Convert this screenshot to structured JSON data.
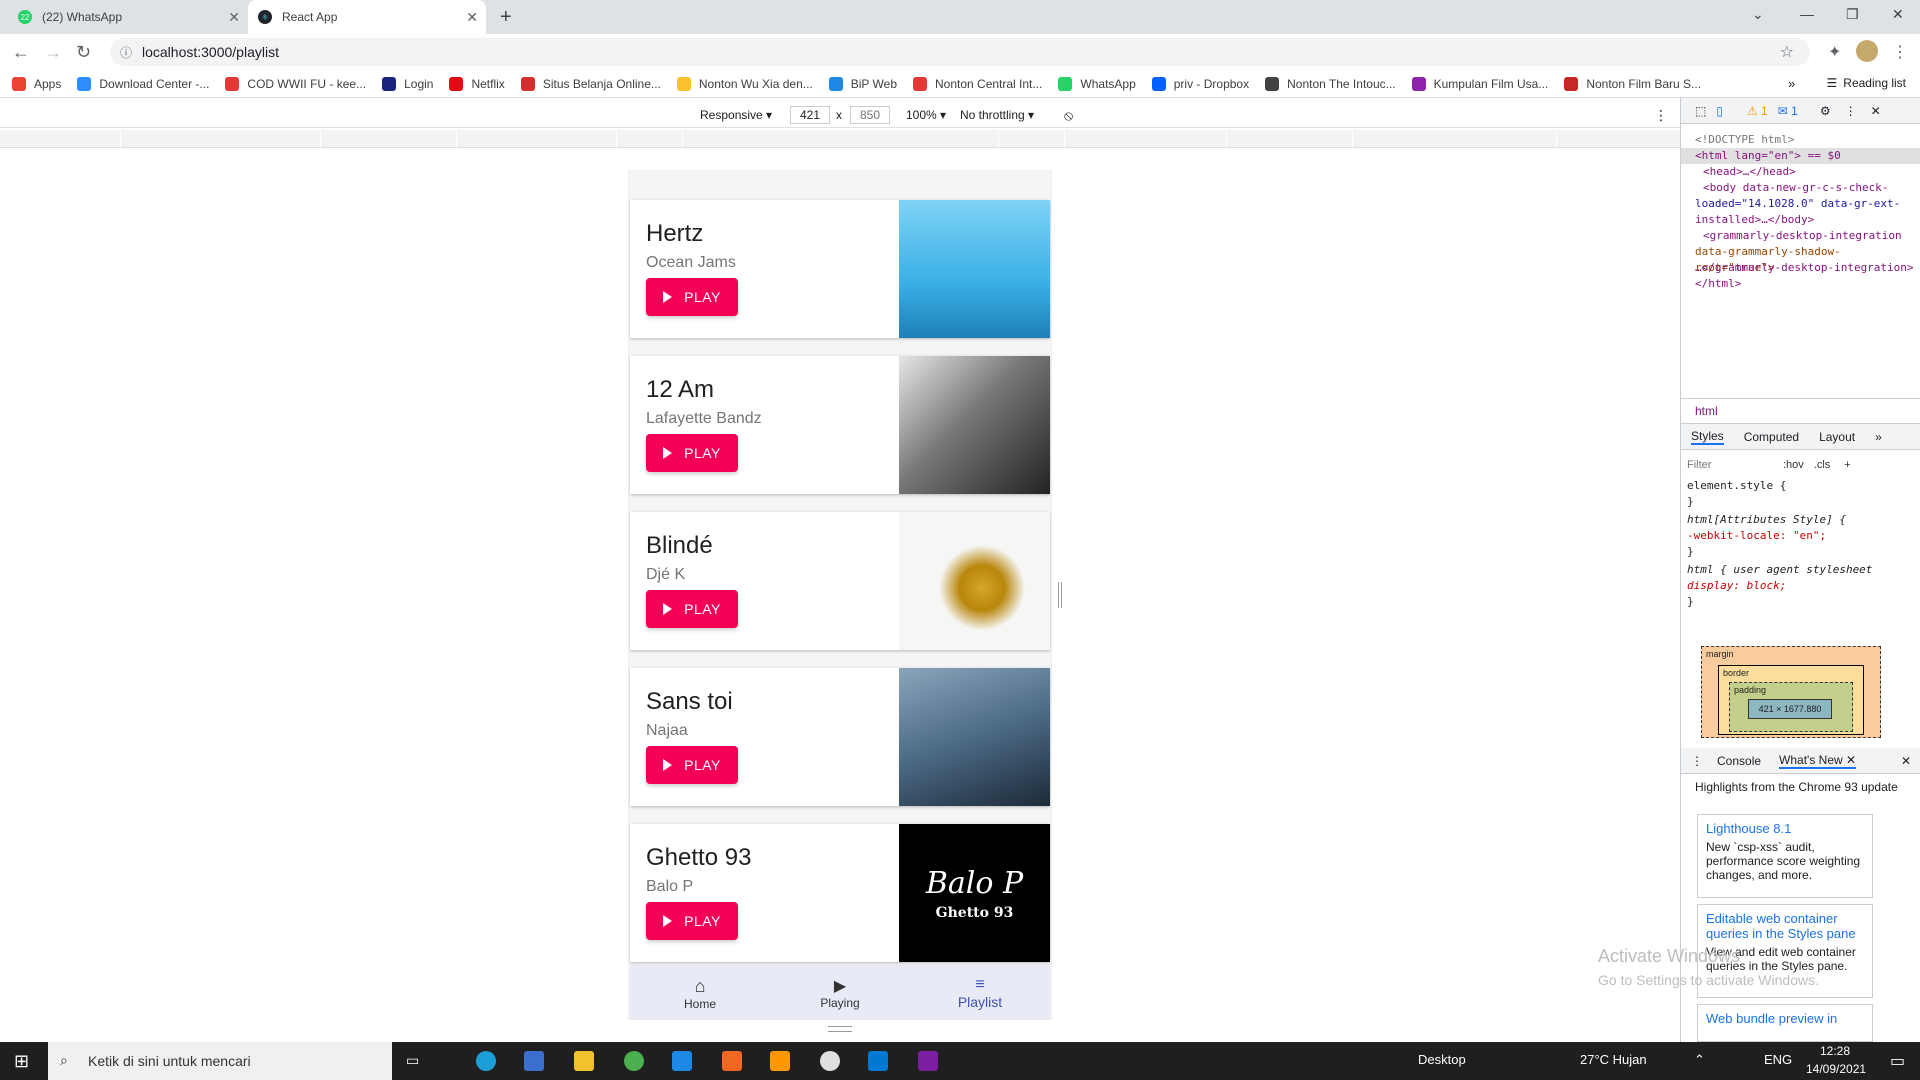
{
  "browser": {
    "tabs": [
      {
        "title": "(22) WhatsApp",
        "active": false,
        "favicon": "whatsapp-icon",
        "favicon_color": "#25d366",
        "badge": "22"
      },
      {
        "title": "React App",
        "active": true,
        "favicon": "react-icon",
        "favicon_color": "#20232a"
      }
    ],
    "url": "localhost:3000/playlist",
    "bookmarks": [
      {
        "label": "Apps",
        "icon": "apps-grid-icon",
        "color": "#ea4335"
      },
      {
        "label": "Download Center -...",
        "icon": "zoom-icon",
        "color": "#2d8cff"
      },
      {
        "label": "COD WWII FU - kee...",
        "icon": "k-icon",
        "color": "#e53935"
      },
      {
        "label": "Login",
        "icon": "check-icon",
        "color": "#1a237e"
      },
      {
        "label": "Netflix",
        "icon": "netflix-icon",
        "color": "#e50914"
      },
      {
        "label": "Situs Belanja Online...",
        "icon": "tokopedia-icon",
        "color": "#d32f2f"
      },
      {
        "label": "Nonton Wu Xia den...",
        "icon": "play-icon",
        "color": "#fbc02d"
      },
      {
        "label": "BiP Web",
        "icon": "bip-icon",
        "color": "#1e88e5"
      },
      {
        "label": "Nonton Central Int...",
        "icon": "play-circle-icon",
        "color": "#e53935"
      },
      {
        "label": "WhatsApp",
        "icon": "whatsapp-icon",
        "color": "#25d366"
      },
      {
        "label": "priv - Dropbox",
        "icon": "dropbox-icon",
        "color": "#0061ff"
      },
      {
        "label": "Nonton The Intouc...",
        "icon": "globe-icon",
        "color": "#424242"
      },
      {
        "label": "Kumpulan Film Usa...",
        "icon": "puzzle-icon",
        "color": "#8e24aa"
      },
      {
        "label": "Nonton Film Baru S...",
        "icon": "puzzle-icon",
        "color": "#c62828"
      }
    ],
    "reading_list": "Reading list",
    "more_bookmarks": "»"
  },
  "emulation": {
    "mode": "Responsive",
    "width": "421",
    "height": "850",
    "zoom": "100%",
    "throttling": "No throttling",
    "times": "x"
  },
  "app": {
    "songs": [
      {
        "title": "Hertz",
        "artist": "Ocean Jams",
        "art": "hertz-cover",
        "art_colors": [
          "#5bc8f0",
          "#1e90c8"
        ]
      },
      {
        "title": "12 Am",
        "artist": "Lafayette Bandz",
        "art": "12am-cover",
        "art_colors": [
          "#d8d8d8",
          "#2b2b2b"
        ]
      },
      {
        "title": "Blindé",
        "artist": "Djé K",
        "art": "blinde-cover",
        "art_colors": [
          "#f4f4f2",
          "#c9a227"
        ]
      },
      {
        "title": "Sans toi",
        "artist": "Najaa",
        "art": "sans-toi-cover",
        "art_colors": [
          "#5a7a95",
          "#1f2d3a"
        ]
      },
      {
        "title": "Ghetto 93",
        "artist": "Balo P",
        "art": "ghetto93-cover",
        "art_colors": [
          "#000000",
          "#000000"
        ],
        "art_text_1": "Balo P",
        "art_text_2": "Ghetto 93"
      }
    ],
    "play_label": "PLAY",
    "nav": [
      {
        "label": "Home",
        "icon": "home-icon"
      },
      {
        "label": "Playing",
        "icon": "play-arrow-icon"
      },
      {
        "label": "Playlist",
        "icon": "playlist-icon",
        "selected": true
      }
    ],
    "accent": "#f50057",
    "nav_selected_color": "#3f51b5"
  },
  "devtools": {
    "warnings": "1",
    "messages": "1",
    "elements": [
      "<!DOCTYPE html>",
      "<html lang=\"en\"> == $0",
      "<head>…</head>",
      "<body data-new-gr-c-s-check-",
      "loaded=\"14.1028.0\" data-gr-ext-",
      "installed>…</body>",
      "<grammarly-desktop-integration",
      "data-grammarly-shadow-root=\"true\">",
      "…</grammarly-desktop-integration>",
      "</html>"
    ],
    "breadcrumb": "html",
    "style_tabs": [
      "Styles",
      "Computed",
      "Layout",
      "»"
    ],
    "filter_placeholder": "Filter",
    "hov": ":hov",
    "cls": ".cls",
    "styles": [
      "element.style {",
      "}",
      "html[Attributes Style] {",
      "  -webkit-locale: \"en\";",
      "}",
      "html {      user agent stylesheet",
      "  display: block;",
      "}"
    ],
    "box_model": {
      "margin": "margin",
      "border": "border",
      "padding": "padding",
      "dash": "–",
      "content": "421 × 1677.880"
    },
    "drawer_tabs": [
      "Console",
      "What's New"
    ],
    "highlights_title": "Highlights from the Chrome 93 update",
    "whatsnew": [
      {
        "title": "Lighthouse 8.1",
        "body": "New `csp-xss` audit, performance score weighting changes, and more."
      },
      {
        "title": "Editable web container queries in the Styles pane",
        "body": "View and edit web container queries in the Styles pane."
      },
      {
        "title": "Web bundle preview in",
        "body": ""
      }
    ]
  },
  "watermark": {
    "line1": "Activate Windows",
    "line2": "Go to Settings to activate Windows."
  },
  "taskbar": {
    "search_placeholder": "Ketik di sini untuk mencari",
    "desktop": "Desktop",
    "weather": "27°C  Hujan",
    "lang": "ENG",
    "time": "12:28",
    "date": "14/09/2021"
  }
}
